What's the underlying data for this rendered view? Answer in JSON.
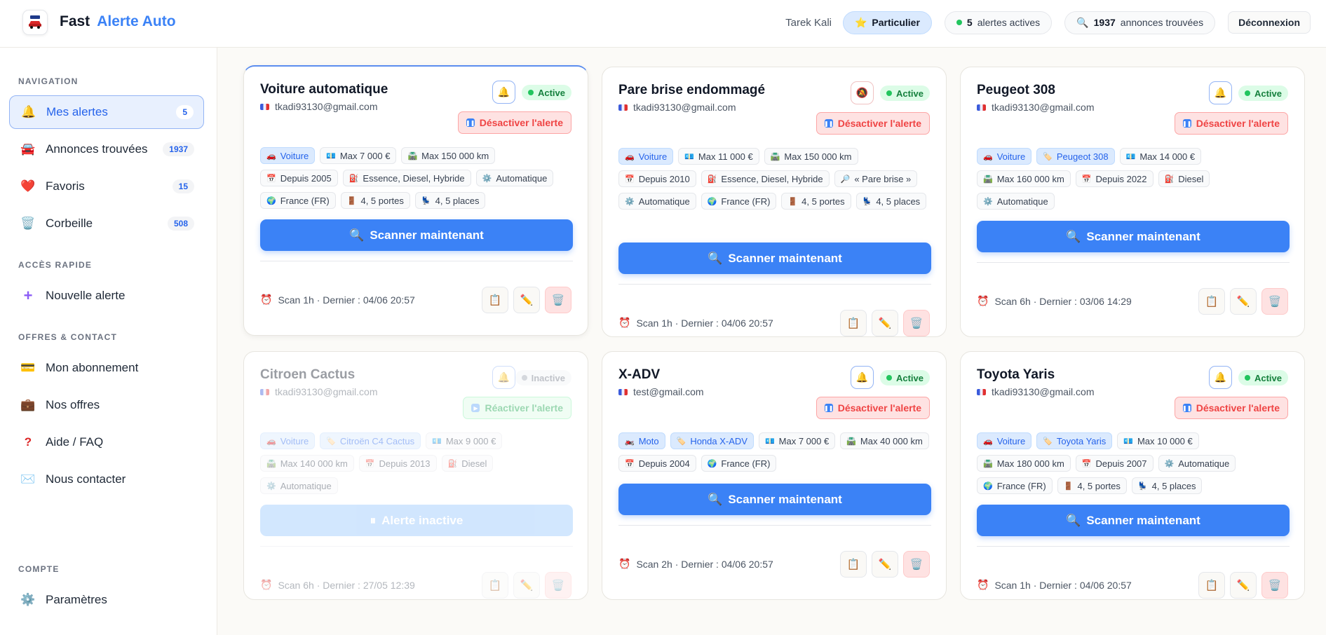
{
  "header": {
    "brand_first": "Fast",
    "brand_second": "Alerte Auto",
    "user_name": "Tarek Kali",
    "plan_label": "Particulier",
    "alerts_count": "5",
    "alerts_label": "alertes actives",
    "ads_count": "1937",
    "ads_label": "annonces trouvées",
    "logout_label": "Déconnexion"
  },
  "sidebar": {
    "nav_title": "NAVIGATION",
    "nav": [
      {
        "label": "Mes alertes",
        "badge": "5",
        "icon": "bell-icon"
      },
      {
        "label": "Annonces trouvées",
        "badge": "1937",
        "icon": "car-icon"
      },
      {
        "label": "Favoris",
        "badge": "15",
        "icon": "heart-icon"
      },
      {
        "label": "Corbeille",
        "badge": "508",
        "icon": "trash-icon"
      }
    ],
    "quick_title": "ACCÈS RAPIDE",
    "quick": [
      {
        "label": "Nouvelle alerte",
        "icon": "plus-icon"
      }
    ],
    "offers_title": "OFFRES & CONTACT",
    "offers": [
      {
        "label": "Mon abonnement",
        "icon": "card-icon"
      },
      {
        "label": "Nos offres",
        "icon": "briefcase-icon"
      },
      {
        "label": "Aide / FAQ",
        "icon": "question-icon"
      },
      {
        "label": "Nous contacter",
        "icon": "envelope-icon"
      }
    ],
    "account_title": "COMPTE",
    "account": [
      {
        "label": "Paramètres",
        "icon": "gear-icon"
      }
    ]
  },
  "cards": [
    {
      "title": "Voiture automatique",
      "email": "tkadi93130@gmail.com",
      "status": "Active",
      "toggle": "Désactiver l'alerte",
      "tags": [
        "Voiture",
        "Max 7 000 €",
        "Max 150 000 km",
        "Depuis 2005",
        "Essence, Diesel, Hybride",
        "Automatique",
        "France (FR)",
        "4, 5 portes",
        "4, 5 places"
      ],
      "scan": "Scanner maintenant",
      "footer": "Scan 1h · Dernier : 04/06 20:57"
    },
    {
      "title": "Pare brise endommagé",
      "email": "tkadi93130@gmail.com",
      "status": "Active",
      "toggle": "Désactiver l'alerte",
      "tags": [
        "Voiture",
        "Max 11 000 €",
        "Max 150 000 km",
        "Depuis 2010",
        "Essence, Diesel, Hybride",
        "« Pare brise »",
        "Automatique",
        "France (FR)",
        "4, 5 portes",
        "4, 5 places"
      ],
      "scan": "Scanner maintenant",
      "footer": "Scan 1h · Dernier : 04/06 20:57"
    },
    {
      "title": "Peugeot 308",
      "email": "tkadi93130@gmail.com",
      "status": "Active",
      "toggle": "Désactiver l'alerte",
      "tags": [
        "Voiture",
        "Peugeot 308",
        "Max 14 000 €",
        "Max 160 000 km",
        "Depuis 2022",
        "Diesel",
        "Automatique"
      ],
      "scan": "Scanner maintenant",
      "footer": "Scan 6h · Dernier : 03/06 14:29"
    },
    {
      "title": "Citroen Cactus",
      "email": "tkadi93130@gmail.com",
      "status": "Inactive",
      "toggle": "Réactiver l'alerte",
      "tags": [
        "Voiture",
        "Citroën C4 Cactus",
        "Max 9 000 €",
        "Max 140 000 km",
        "Depuis 2013",
        "Diesel",
        "Automatique"
      ],
      "scan": "Alerte inactive",
      "footer": "Scan 6h · Dernier : 27/05 12:39"
    },
    {
      "title": "X-ADV",
      "email": "test@gmail.com",
      "status": "Active",
      "toggle": "Désactiver l'alerte",
      "tags": [
        "Moto",
        "Honda X-ADV",
        "Max 7 000 €",
        "Max 40 000 km",
        "Depuis 2004",
        "France (FR)"
      ],
      "scan": "Scanner maintenant",
      "footer": "Scan 2h · Dernier : 04/06 20:57"
    },
    {
      "title": "Toyota Yaris",
      "email": "tkadi93130@gmail.com",
      "status": "Active",
      "toggle": "Désactiver l'alerte",
      "tags": [
        "Voiture",
        "Toyota Yaris",
        "Max 10 000 €",
        "Max 180 000 km",
        "Depuis 2007",
        "Automatique",
        "France (FR)",
        "4, 5 portes",
        "4, 5 places"
      ],
      "scan": "Scanner maintenant",
      "footer": "Scan 1h · Dernier : 04/06 20:57"
    }
  ]
}
